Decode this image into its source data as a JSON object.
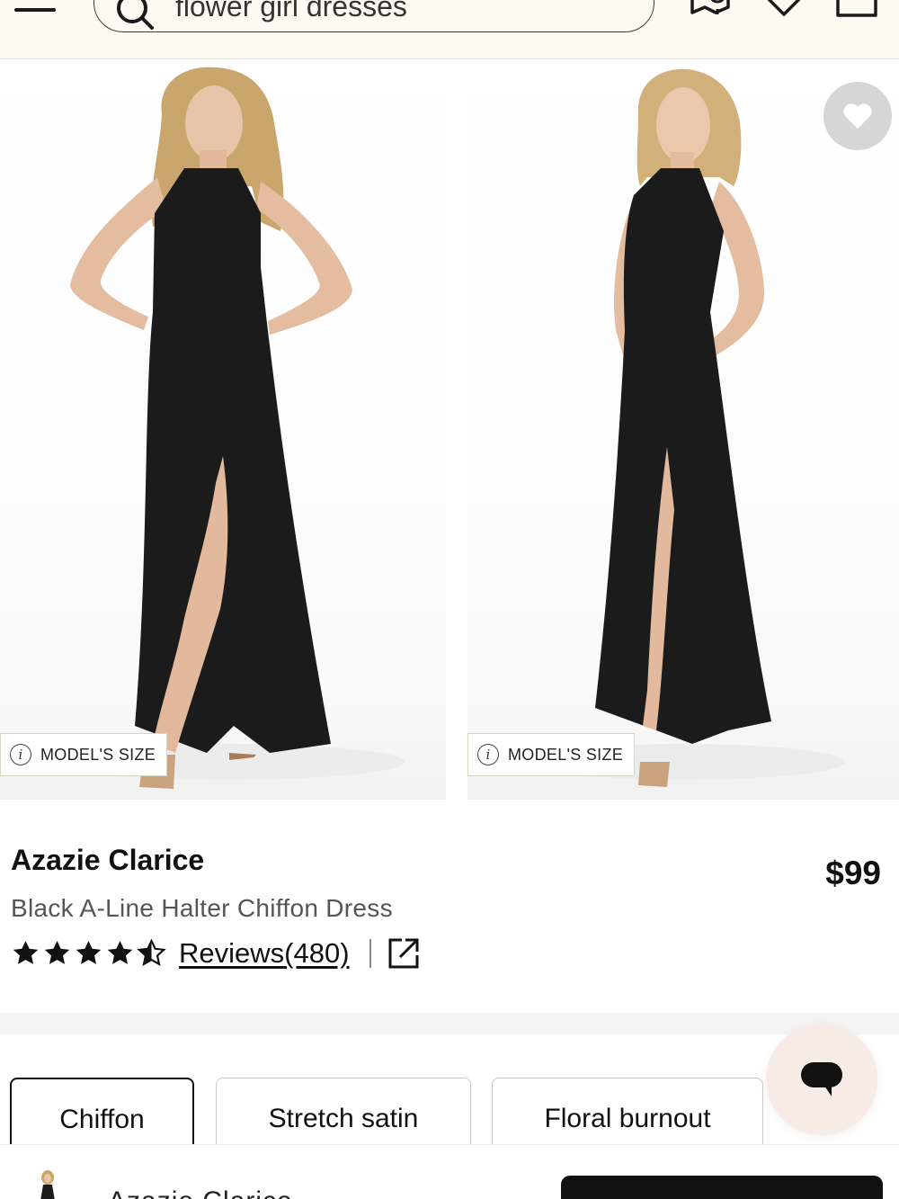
{
  "header": {
    "search_text": "flower girl dresses",
    "icons": [
      "menu-icon",
      "search-icon",
      "location-icon",
      "heart-icon",
      "bag-icon"
    ]
  },
  "gallery": {
    "photos": [
      {
        "model_size_label": "MODEL'S SIZE"
      },
      {
        "model_size_label": "MODEL'S SIZE"
      }
    ],
    "favorite_icon": "heart-icon"
  },
  "product": {
    "brand": "Azazie Clarice",
    "subtitle": "Black A-Line Halter Chiffon Dress",
    "price": "$99",
    "rating_out_of_5": 4.5,
    "reviews_label": "Reviews(480)"
  },
  "fabrics": [
    {
      "label": "Chiffon",
      "selected": true
    },
    {
      "label": "Stretch satin",
      "selected": false
    },
    {
      "label": "Floral burnout",
      "selected": false
    }
  ],
  "bottom_bar": {
    "product_name": "Azazie Clarice"
  },
  "colors": {
    "header_bg": "#fdfbf1",
    "dress": "#1b1b1b",
    "chat_bg": "#f7ece6",
    "cta_bg": "#111111"
  }
}
